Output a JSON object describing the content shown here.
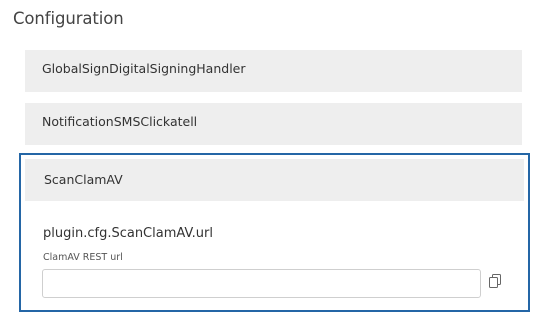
{
  "section": {
    "title": "Configuration"
  },
  "plugins": {
    "items": [
      {
        "name": "GlobalSignDigitalSigningHandler"
      },
      {
        "name": "NotificationSMSClickatell"
      }
    ],
    "expanded": {
      "name": "ScanClamAV",
      "setting": {
        "key": "plugin.cfg.ScanClamAV.url",
        "description": "ClamAV REST url",
        "value": "",
        "placeholder": ""
      }
    }
  },
  "icons": {
    "copy": "copy-icon"
  },
  "colors": {
    "accent_border": "#2466a6",
    "header_bg": "#eeeeee"
  }
}
